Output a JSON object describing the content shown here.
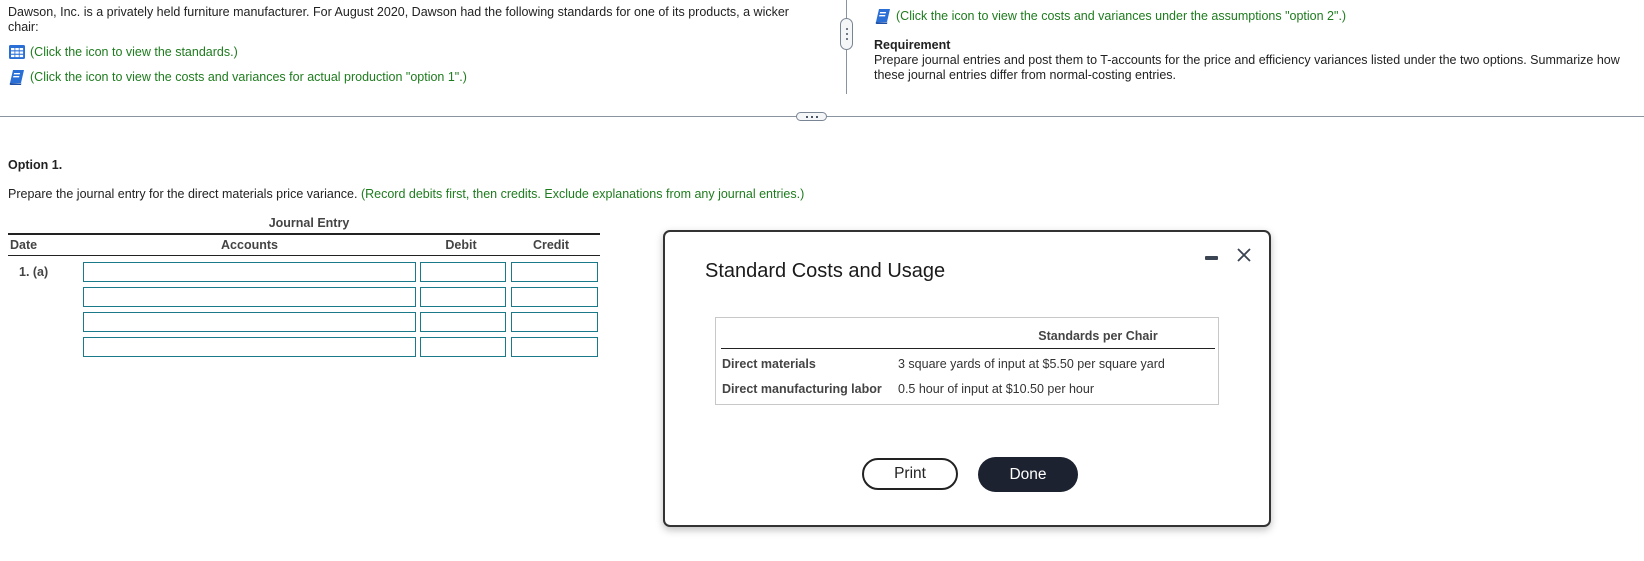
{
  "intro": {
    "text": "Dawson, Inc. is a privately held furniture manufacturer. For August 2020, Dawson had the following standards for one of its products, a wicker chair:",
    "links": [
      {
        "icon": "table-grid-icon",
        "label": "(Click the icon to view the standards.)"
      },
      {
        "icon": "book-icon",
        "label": "(Click the icon to view the costs and variances for actual production \"option 1\".)"
      }
    ]
  },
  "right_panel": {
    "link": {
      "icon": "book-icon",
      "label": "(Click the icon to view the costs and variances under the assumptions \"option 2\".)"
    },
    "requirement_title": "Requirement",
    "requirement_text": "Prepare journal entries and post them to T-accounts for the price and efficiency variances listed under the two options. Summarize how these journal entries differ from normal-costing entries."
  },
  "option": {
    "title": "Option 1.",
    "instruction": "Prepare the journal entry for the direct materials price variance.",
    "instruction_note": "(Record debits first, then credits. Exclude explanations from any journal entries.)"
  },
  "journal": {
    "title": "Journal Entry",
    "columns": {
      "date": "Date",
      "accounts": "Accounts",
      "debit": "Debit",
      "credit": "Credit"
    },
    "rows": [
      {
        "date": "1. (a)",
        "account": "",
        "debit": "",
        "credit": ""
      },
      {
        "date": "",
        "account": "",
        "debit": "",
        "credit": ""
      },
      {
        "date": "",
        "account": "",
        "debit": "",
        "credit": ""
      },
      {
        "date": "",
        "account": "",
        "debit": "",
        "credit": ""
      }
    ]
  },
  "modal": {
    "title": "Standard Costs and Usage",
    "column_header": "Standards per Chair",
    "rows": [
      {
        "label": "Direct materials",
        "value": "3 square yards of input at $5.50 per square yard"
      },
      {
        "label": "Direct manufacturing labor",
        "value": "0.5 hour of input at $10.50 per hour"
      }
    ],
    "print_label": "Print",
    "done_label": "Done"
  },
  "colors": {
    "link_green": "#1e7c1e",
    "input_border": "#1a7a8a",
    "done_button": "#1c2230",
    "icon_blue": "#2a6fd6"
  }
}
